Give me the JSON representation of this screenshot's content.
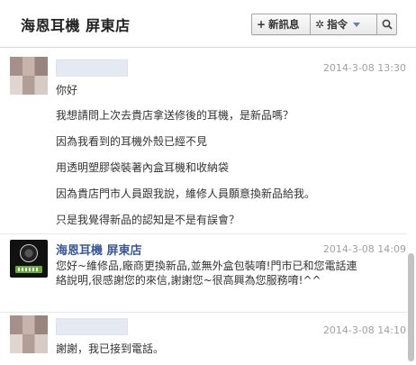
{
  "header": {
    "title": "海恩耳機 屏東店",
    "new_message_label": "新訊息",
    "actions_label": "指令"
  },
  "messages": [
    {
      "author": "",
      "time": "2014-3-08 13:30",
      "lines": [
        "你好",
        "我想請問上次去貴店拿送修後的耳機，是新品嗎？",
        "因為我看到的耳機外殼已經不見",
        "用透明塑膠袋裝著內盒耳機和收納袋",
        "因為貴店門市人員跟我說，維修人員願意換新品給我。",
        "只是我覺得新品的認知是不是有誤會？"
      ]
    },
    {
      "author": "海恩耳機 屏東店",
      "time": "2014-3-08 14:09",
      "text": "您好~維修品,廠商更換新品,並無外盒包裝唷!門市已和您電話連絡說明,很感謝您的來信,謝謝您~很高興為您服務唷!^^"
    },
    {
      "author": "",
      "time": "2014-3-08 14:10",
      "lines": [
        "謝謝，我已接到電話。"
      ]
    }
  ]
}
